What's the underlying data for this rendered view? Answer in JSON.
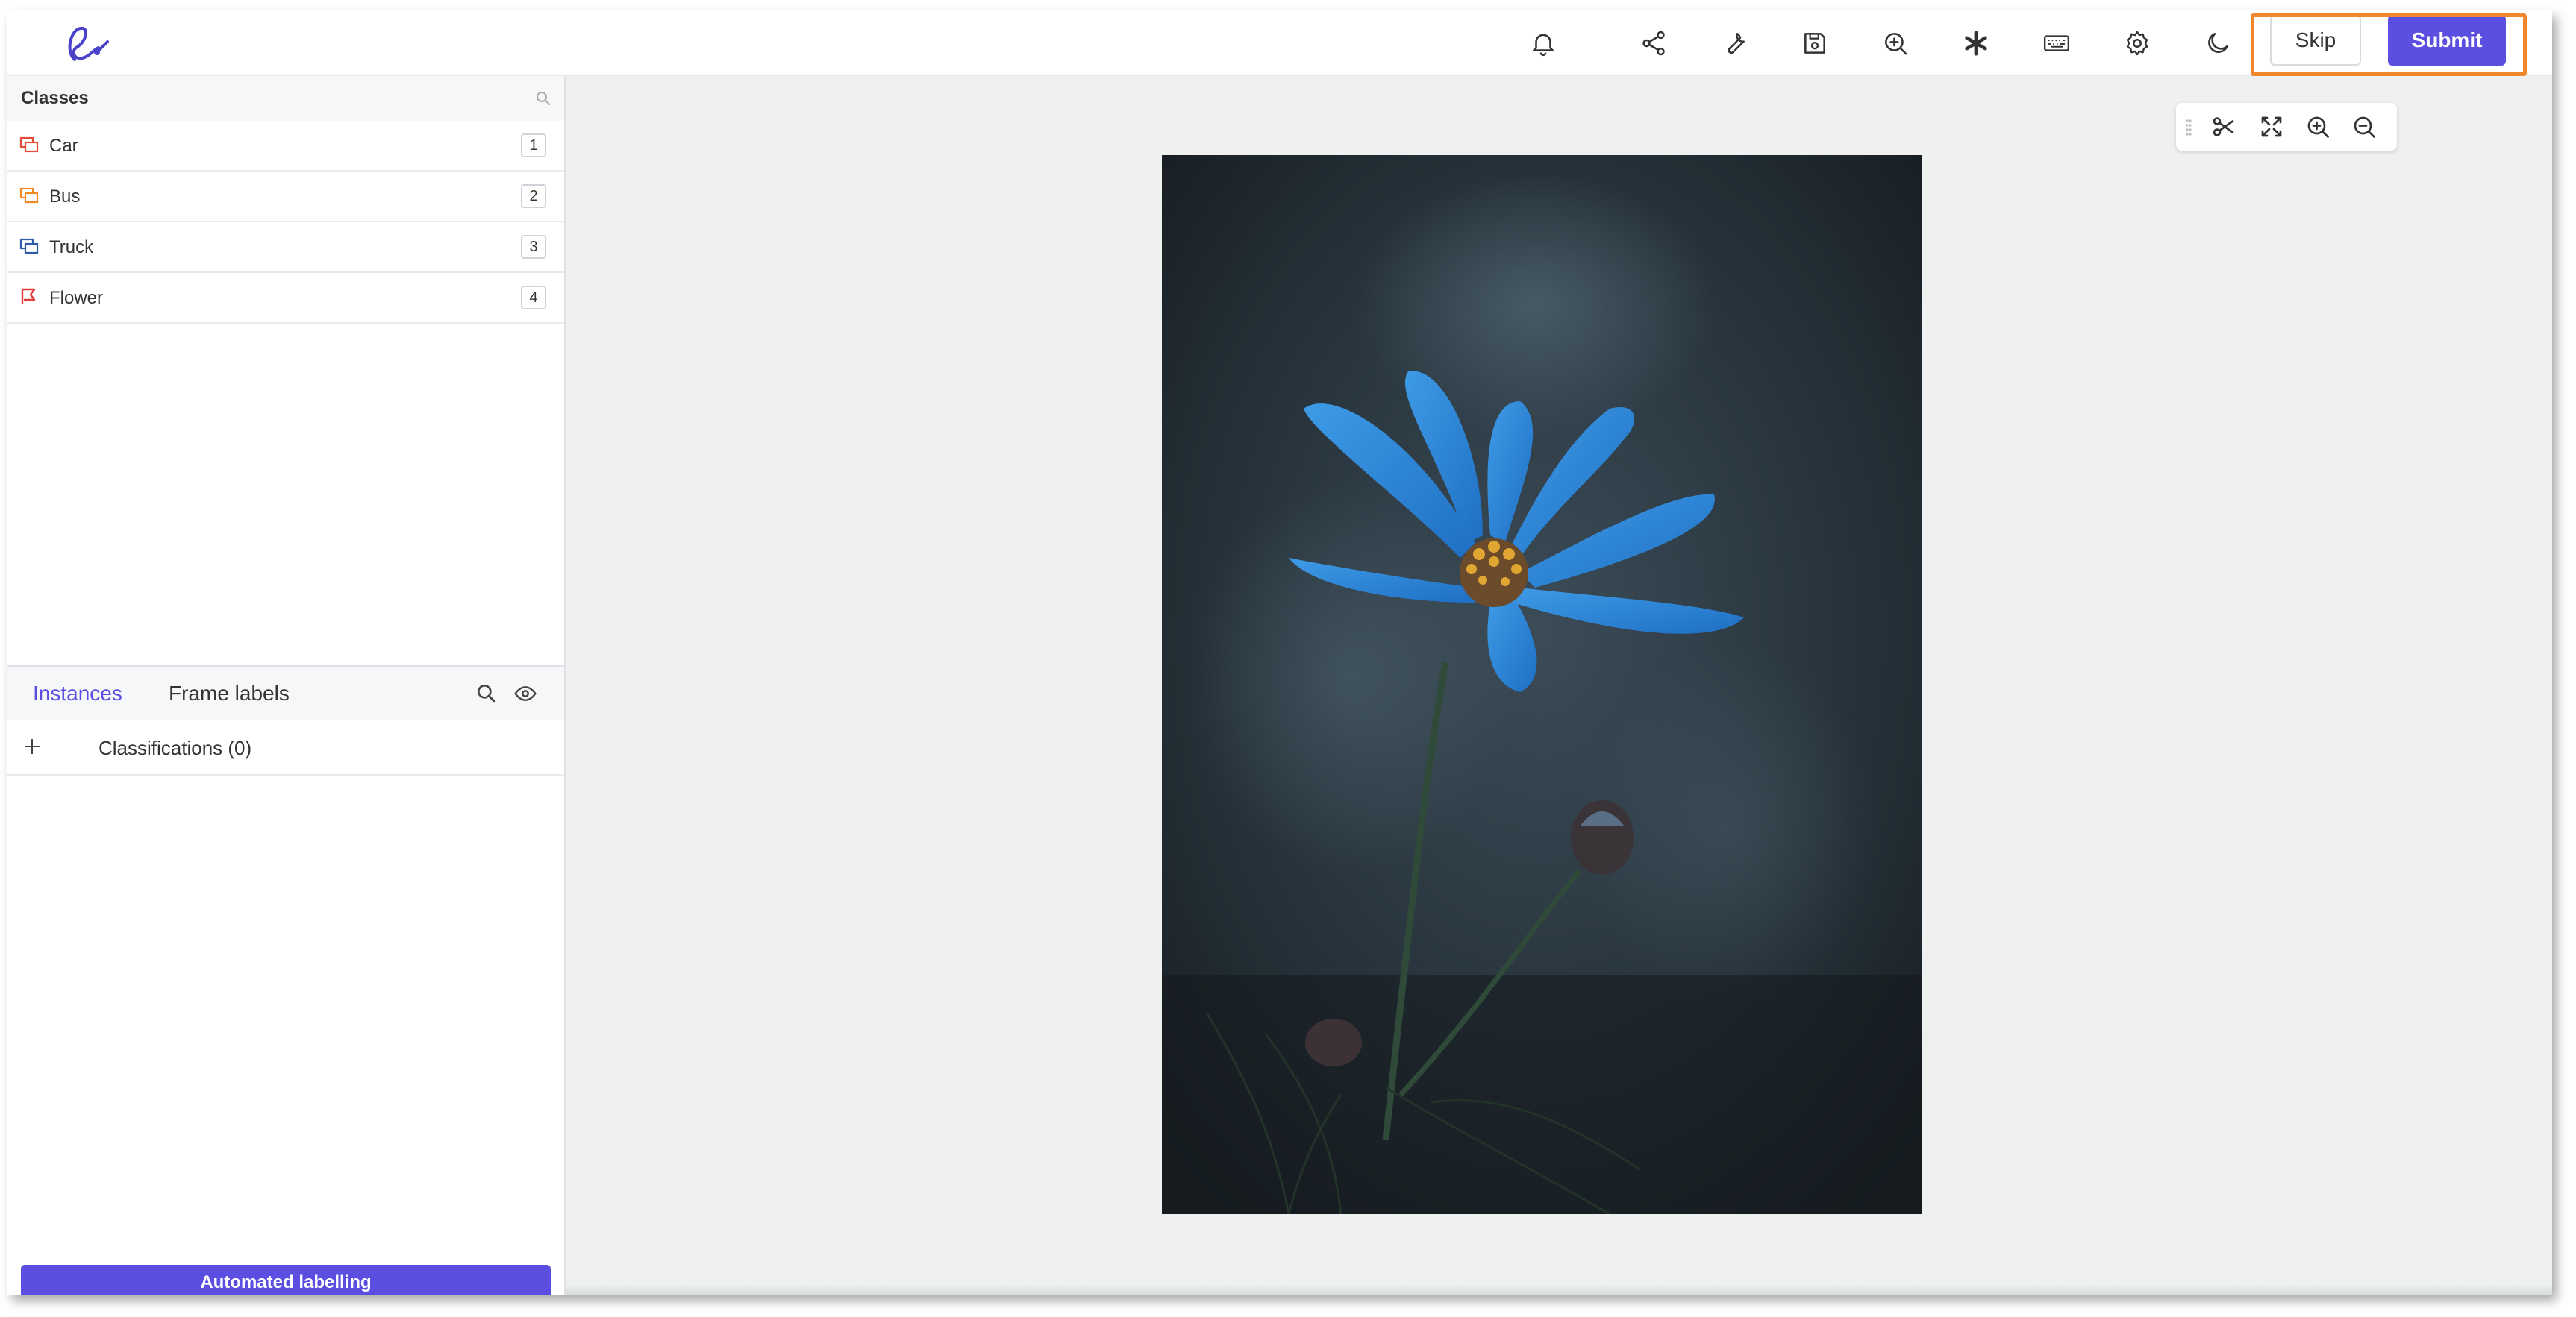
{
  "topbar": {
    "skip_label": "Skip",
    "submit_label": "Submit",
    "icons": [
      "bell-icon",
      "share-icon",
      "wrench-icon",
      "save-icon",
      "zoom-search-icon",
      "asterisk-icon",
      "keyboard-icon",
      "gear-icon",
      "moon-icon"
    ]
  },
  "classes": {
    "title": "Classes",
    "items": [
      {
        "label": "Car",
        "key": "1",
        "color": "#e34b3a"
      },
      {
        "label": "Bus",
        "key": "2",
        "color": "#f08a24"
      },
      {
        "label": "Truck",
        "key": "3",
        "color": "#2e5aa8"
      },
      {
        "label": "Flower",
        "key": "4",
        "color": "#e03b3b"
      }
    ]
  },
  "instances": {
    "tab_instances": "Instances",
    "tab_frame_labels": "Frame labels",
    "classifications_label": "Classifications (0)"
  },
  "footer": {
    "automated_labelling": "Automated labelling"
  },
  "canvas_toolbar": {
    "icons": [
      "drag-handle-icon",
      "scissors-icon",
      "fit-screen-icon",
      "zoom-in-icon",
      "zoom-out-icon"
    ]
  },
  "colors": {
    "accent": "#5a4fe0",
    "highlight": "#f0862e",
    "canvas_bg": "#eff1f1"
  }
}
